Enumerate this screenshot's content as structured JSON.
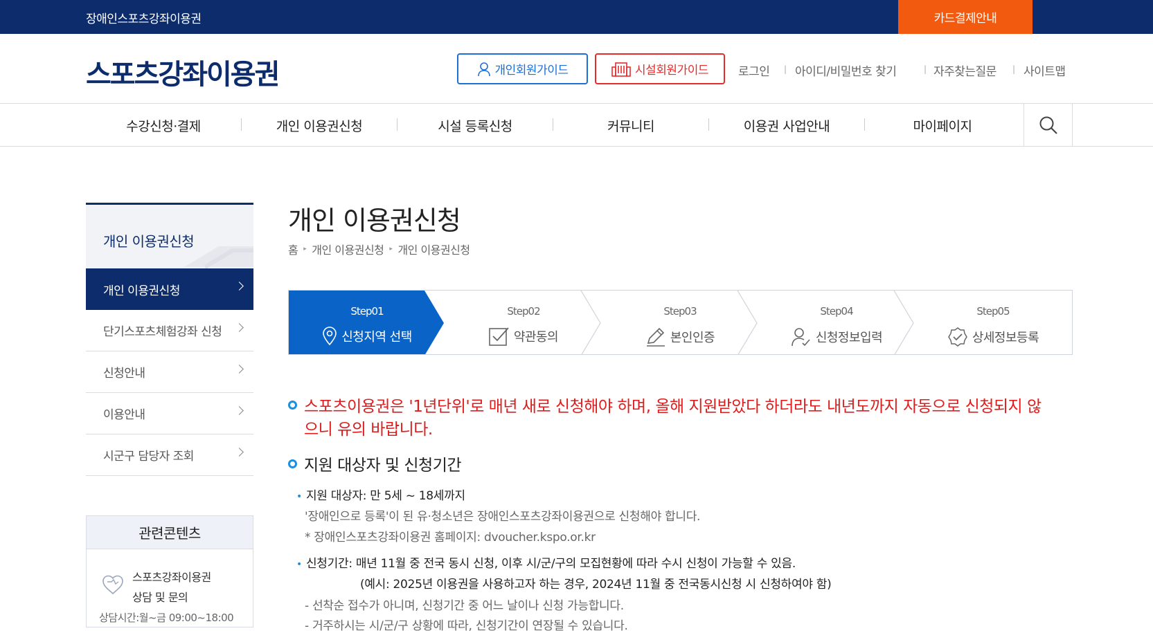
{
  "topbar": {
    "site_link": "장애인스포츠강좌이용권",
    "card_button": "카드결제안내"
  },
  "header": {
    "logo": "스포츠강좌이용권",
    "guide_personal": "개인회원가이드",
    "guide_facility": "시설회원가이드",
    "util": [
      "로그인",
      "아이디/비밀번호 찾기",
      "자주찾는질문",
      "사이트맵"
    ]
  },
  "gnb": [
    "수강신청·결제",
    "개인 이용권신청",
    "시설 등록신청",
    "커뮤니티",
    "이용권 사업안내",
    "마이페이지"
  ],
  "lnb": {
    "title": "개인 이용권신청",
    "items": [
      "개인 이용권신청",
      "단기스포츠체험강좌 신청",
      "신청안내",
      "이용안내",
      "시군구 담당자 조회"
    ]
  },
  "related": {
    "title": "관련콘텐츠",
    "line1": "스포츠강좌이용권",
    "line2": "상담 및 문의",
    "time": "상담시간:월~금 09:00~18:00"
  },
  "page": {
    "title": "개인 이용권신청",
    "breadcrumb": [
      "홈",
      "개인 이용권신청",
      "개인 이용권신청"
    ]
  },
  "steps": [
    {
      "num": "Step01",
      "name": "신청지역 선택",
      "icon": "location-pin-icon"
    },
    {
      "num": "Step02",
      "name": "약관동의",
      "icon": "checkbox-icon"
    },
    {
      "num": "Step03",
      "name": "본인인증",
      "icon": "pencil-icon"
    },
    {
      "num": "Step04",
      "name": "신청정보입력",
      "icon": "user-check-icon"
    },
    {
      "num": "Step05",
      "name": "상세정보등록",
      "icon": "check-badge-icon"
    }
  ],
  "content": {
    "notice_line1": "스포츠이용권은 '1년단위'로 매년 새로 신청해야 하며, 올해 지원받았다 하더라도 내년도까지 자동으로 신청되지 않",
    "notice_line2": "으니 유의 바랍니다.",
    "section_title": "지원 대상자 및 신청기간",
    "target_label": "지원 대상자: 만 5세 ~ 18세까지",
    "target_sub1": "'장애인으로 등록'이 된 유·청소년은 장애인스포츠강좌이용권으로 신청해야 합니다.",
    "target_sub2": "* 장애인스포츠강좌이용권 홈페이지: dvoucher.kspo.or.kr",
    "period_label": "신청기간: 매년 11월 중 전국 동시 신청, 이후 시/군/구의 모집현황에 따라 수시 신청이 가능할 수 있음.",
    "period_sub1": "(예시: 2025년 이용권을 사용하고자 하는 경우, 2024년 11월 중 전국동시신청 시 신청하여야 함)",
    "period_sub2": "- 선착순 접수가 아니며, 신청기간 중 어느 날이나 신청 가능합니다.",
    "period_sub3": "- 거주하시는 시/군/구 상황에 따라, 신청기간이 연장될 수 있습니다."
  },
  "colors": {
    "navy": "#0c2c6b",
    "orange": "#f15a0f",
    "blue": "#0a64c8",
    "red": "#e01b1b"
  }
}
